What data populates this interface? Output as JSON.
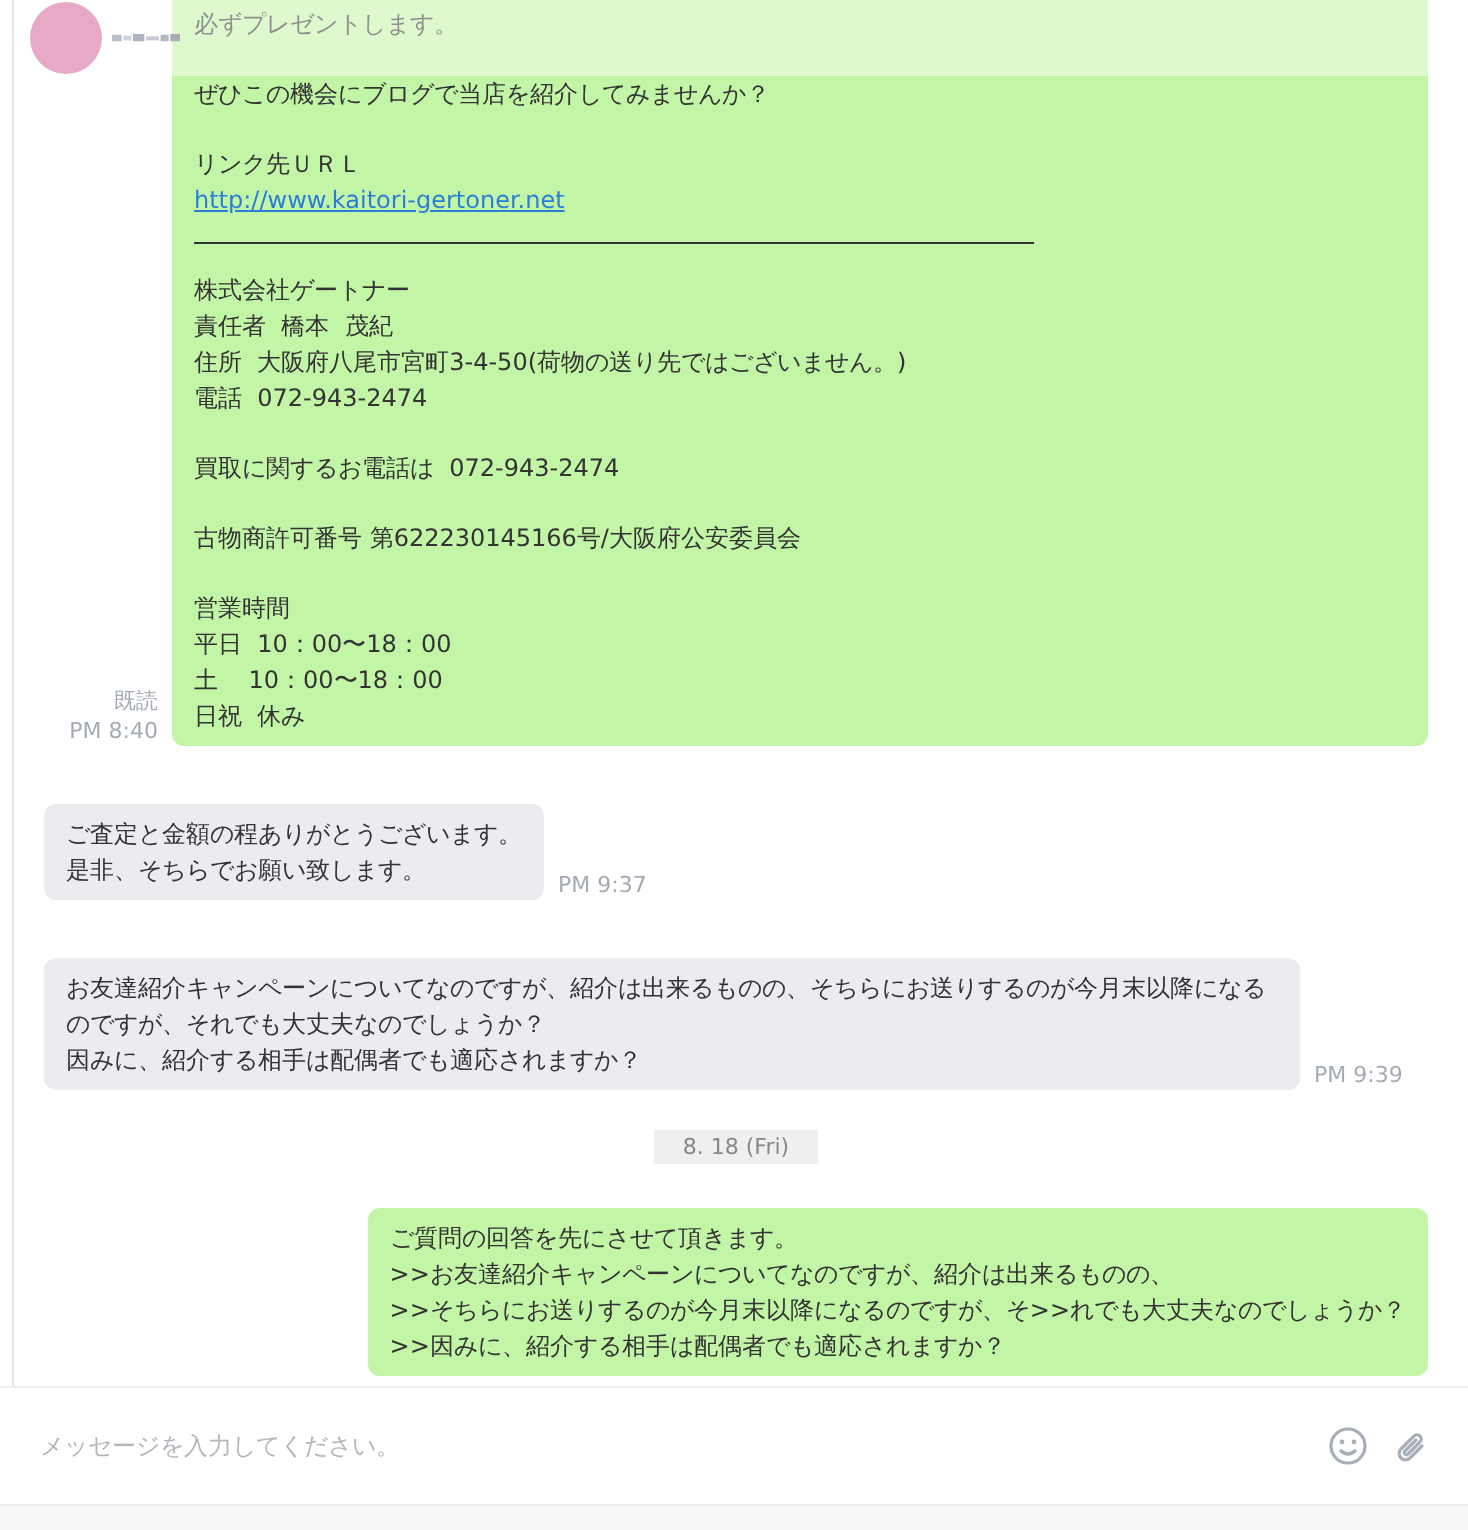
{
  "messages": [
    {
      "kind": "sent",
      "read": "既読",
      "time": "PM 8:40",
      "lines": [
        {
          "kind": "text",
          "text": "必ずプレゼントします。"
        },
        {
          "kind": "gap"
        },
        {
          "kind": "text",
          "text": "ぜひこの機会にブログで当店を紹介してみませんか？"
        },
        {
          "kind": "gap"
        },
        {
          "kind": "text",
          "text": "リンク先ＵＲＬ"
        },
        {
          "kind": "link",
          "text": "http://www.kaitori-gertoner.net"
        },
        {
          "kind": "rule"
        },
        {
          "kind": "text",
          "text": "株式会社ゲートナー"
        },
        {
          "kind": "text",
          "text": "責任者  橋本  茂紀"
        },
        {
          "kind": "text",
          "text": "住所  大阪府八尾市宮町3-4-50(荷物の送り先ではございません。)"
        },
        {
          "kind": "text",
          "text": "電話  072-943-2474"
        },
        {
          "kind": "gap"
        },
        {
          "kind": "text",
          "text": "買取に関するお電話は  072-943-2474"
        },
        {
          "kind": "gap"
        },
        {
          "kind": "text",
          "text": "古物商許可番号 第622230145166号/大阪府公安委員会"
        },
        {
          "kind": "gap"
        },
        {
          "kind": "text",
          "text": "営業時間"
        },
        {
          "kind": "text",
          "text": "平日  10：00〜18：00"
        },
        {
          "kind": "text",
          "text": "土    10：00〜18：00"
        },
        {
          "kind": "text",
          "text": "日祝  休み"
        }
      ]
    },
    {
      "kind": "received",
      "time": "PM 9:37",
      "lines": [
        {
          "kind": "text",
          "text": "ご査定と金額の程ありがとうございます。"
        },
        {
          "kind": "text",
          "text": "是非、そちらでお願い致します。"
        }
      ]
    },
    {
      "kind": "received",
      "time": "PM 9:39",
      "lines": [
        {
          "kind": "text",
          "text": "お友達紹介キャンペーンについてなのですが、紹介は出来るものの、そちらにお送りするのが今月末以降になるのですが、それでも大丈夫なのでしょうか？"
        },
        {
          "kind": "text",
          "text": "因みに、紹介する相手は配偶者でも適応されますか？"
        }
      ]
    },
    {
      "kind": "date",
      "text": "8. 18 (Fri)"
    },
    {
      "kind": "sent",
      "lines": [
        {
          "kind": "text",
          "text": "ご質問の回答を先にさせて頂きます。"
        },
        {
          "kind": "text",
          "text": ">>お友達紹介キャンペーンについてなのですが、紹介は出来るものの、"
        },
        {
          "kind": "text",
          "text": ">>そちらにお送りするのが今月末以降になるのですが、そ>>れでも大丈夫なのでしょうか？"
        },
        {
          "kind": "text",
          "text": ">>因みに、紹介する相手は配偶者でも適応されますか？"
        }
      ]
    }
  ],
  "composer": {
    "placeholder": "メッセージを入力してください。"
  }
}
